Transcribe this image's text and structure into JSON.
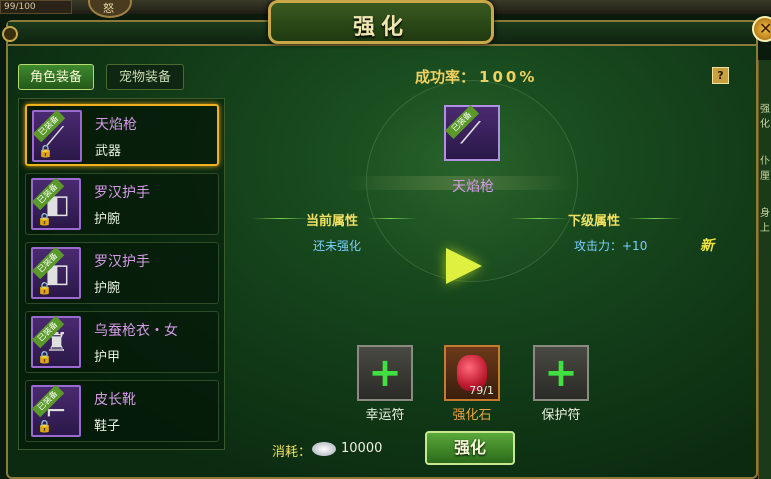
{
  "top": {
    "hp_text": "99/100",
    "circle_char": "怒"
  },
  "title": "强化",
  "right_strip_chars": "强\n化\n\n\n仆\n厘\n\n\n身\n上",
  "tabs": [
    {
      "label": "角色装备",
      "active": true
    },
    {
      "label": "宠物装备",
      "active": false
    }
  ],
  "equip_badge": "已装备",
  "items": [
    {
      "name": "天焰枪",
      "type": "武器",
      "icon": "spear-icon",
      "selected": true
    },
    {
      "name": "罗汉护手",
      "type": "护腕",
      "icon": "bracer-icon",
      "selected": false
    },
    {
      "name": "罗汉护手",
      "type": "护腕",
      "icon": "bracer-icon",
      "selected": false
    },
    {
      "name": "乌蚕枪衣・女",
      "type": "护甲",
      "icon": "armor-icon",
      "selected": false
    },
    {
      "name": "皮长靴",
      "type": "鞋子",
      "icon": "boots-icon",
      "selected": false
    }
  ],
  "success_rate": {
    "label": "成功率：",
    "value": "100%"
  },
  "help_label": "?",
  "center_item": {
    "name": "天焰枪",
    "icon": "spear-icon"
  },
  "current_attr": {
    "header": "当前属性",
    "value": "还未强化"
  },
  "next_attr": {
    "header": "下级属性",
    "value": "攻击力：+10",
    "new_tag": "新"
  },
  "materials": [
    {
      "label": "幸运符",
      "icon": "plus-icon"
    },
    {
      "label": "强化石",
      "icon": "gem-icon",
      "count": "79/1"
    },
    {
      "label": "保护符",
      "icon": "plus-icon"
    }
  ],
  "cost": {
    "label": "消耗：",
    "value": "10000",
    "icon": "silver-ingot-icon"
  },
  "enhance_button": "强化",
  "close_label": "✕"
}
